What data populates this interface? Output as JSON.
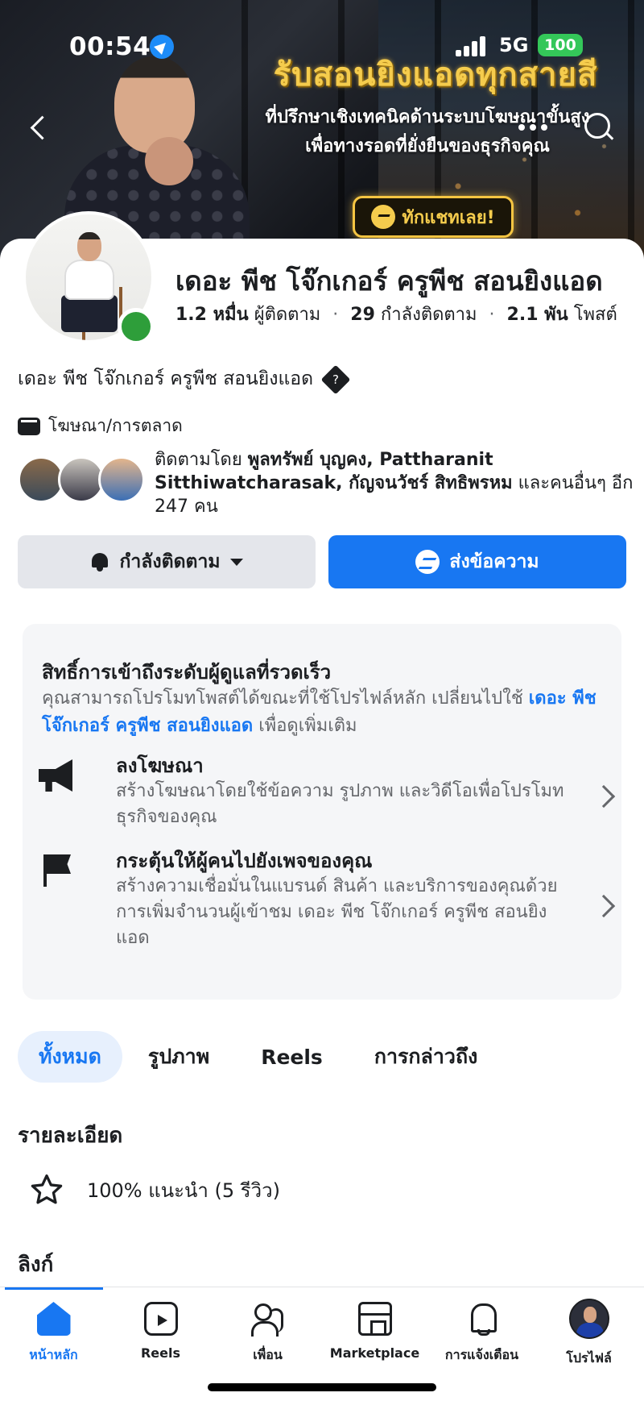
{
  "status_bar": {
    "time": "00:54",
    "network": "5G",
    "battery": "100"
  },
  "cover": {
    "headline": "รับสอนยิงแอดทุกสายสี",
    "subline1": "ที่ปรึกษาเชิงเทคนิคด้านระบบโฆษณาขั้นสูง",
    "subline2": "เพื่อทางรอดที่ยั่งยืนของธุรกิจคุณ",
    "chat_button": "ทักแชทเลย!"
  },
  "profile": {
    "name": "เดอะ พีช โจ๊กเกอร์ ครูพีช สอนยิงแอด",
    "followers_value": "1.2 หมื่น",
    "followers_label": "ผู้ติดตาม",
    "following_value": "29",
    "following_label": "กำลังติดตาม",
    "posts_value": "2.1 พัน",
    "posts_label": "โพสต์",
    "bio": "เดอะ พีช โจ๊กเกอร์ ครูพีช สอนยิงแอด",
    "bio_symbol": "?",
    "category": "โฆษณา/การตลาด",
    "followed_by_prefix": "ติดตามโดย",
    "followed_by_names": "พูลทรัพย์ บุญคง, Pattharanit Sitthiwatcharasak, กัญจนวัชร์ สิทธิพรหม",
    "followed_by_suffix": "และคนอื่นๆ อีก 247 คน"
  },
  "actions": {
    "following_button": "กำลังติดตาม",
    "message_button": "ส่งข้อความ"
  },
  "admin_card": {
    "title": "สิทธิ์การเข้าถึงระดับผู้ดูแลที่รวดเร็ว",
    "desc_prefix": "คุณสามารถโปรโมทโพสต์ได้ขณะที่ใช้โปรไฟล์หลัก เปลี่ยนไปใช้",
    "desc_link": "เดอะ พีช โจ๊กเกอร์ ครูพีช สอนยิงแอด",
    "desc_suffix": "เพื่อดูเพิ่มเติม",
    "items": [
      {
        "title": "ลงโฆษณา",
        "subtitle": "สร้างโฆษณาโดยใช้ข้อความ รูปภาพ และวิดีโอเพื่อโปรโมทธุรกิจของคุณ",
        "icon": "megaphone-icon"
      },
      {
        "title": "กระตุ้นให้ผู้คนไปยังเพจของคุณ",
        "subtitle": "สร้างความเชื่อมั่นในแบรนด์ สินค้า และบริการของคุณด้วยการเพิ่มจำนวนผู้เข้าชม เดอะ พีช โจ๊กเกอร์ ครูพีช สอนยิงแอด",
        "icon": "flag-icon"
      }
    ]
  },
  "tabs": [
    {
      "label": "ทั้งหมด",
      "active": true
    },
    {
      "label": "รูปภาพ",
      "active": false
    },
    {
      "label": "Reels",
      "active": false
    },
    {
      "label": "การกล่าวถึง",
      "active": false
    }
  ],
  "details": {
    "heading": "รายละเอียด",
    "review": "100% แนะนำ (5 รีวิว)",
    "review_percent": 100,
    "links_heading": "ลิงก์"
  },
  "bottom_nav": [
    {
      "label": "หน้าหลัก",
      "icon": "home-icon",
      "active": true
    },
    {
      "label": "Reels",
      "icon": "reels-icon",
      "active": false
    },
    {
      "label": "เพื่อน",
      "icon": "friends-icon",
      "active": false
    },
    {
      "label": "Marketplace",
      "icon": "marketplace-icon",
      "active": false
    },
    {
      "label": "การแจ้งเตือน",
      "icon": "bell-icon",
      "active": false
    },
    {
      "label": "โปรไฟล์",
      "icon": "profile-avatar",
      "active": false
    }
  ],
  "colors": {
    "accent": "#1877f2",
    "online": "#2e9e3a",
    "cover_gold": "#f5cc4d"
  }
}
